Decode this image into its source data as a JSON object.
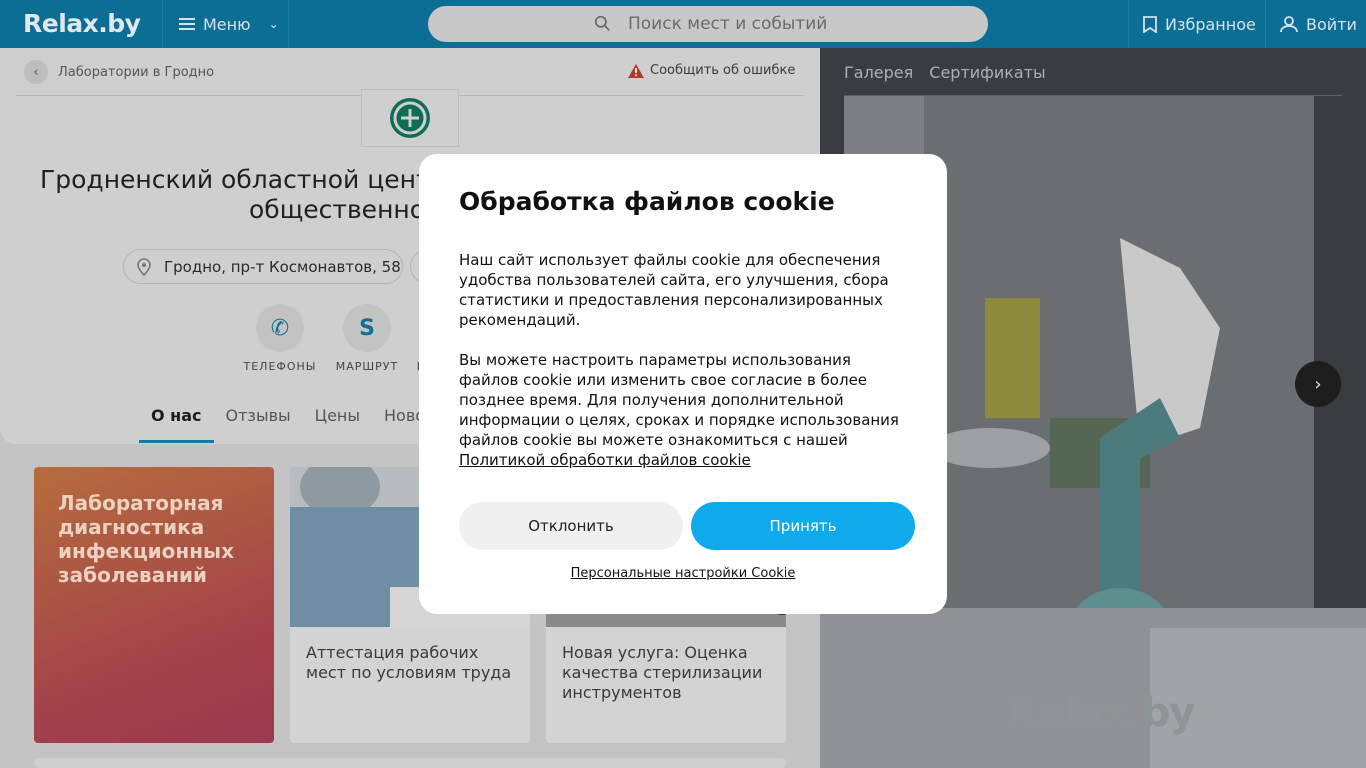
{
  "header": {
    "logo": "Relax.by",
    "menu_label": "Меню",
    "search_placeholder": "Поиск мест и событий",
    "favorites_label": "Избранное",
    "login_label": "Войти"
  },
  "breadcrumb": {
    "back_label": "Лаборатории в Гродно",
    "report_label": "Сообщить об ошибке"
  },
  "org": {
    "title_line1": "Гродненский областной центр",
    "title_line2": "общественно",
    "address": "Гродно, пр-т Космонавтов, 58"
  },
  "actions": [
    {
      "label": "ТЕЛЕФОНЫ",
      "icon": "phone-icon"
    },
    {
      "label": "МАРШРУТ",
      "icon": "route-icon"
    },
    {
      "label": "В",
      "icon": ""
    }
  ],
  "tabs": [
    {
      "label": "О нас",
      "active": true
    },
    {
      "label": "Отзывы",
      "active": false
    },
    {
      "label": "Цены",
      "active": false
    },
    {
      "label": "Ново",
      "active": false
    }
  ],
  "cards": {
    "promo": "Лабораторная диагностика инфекционных заболеваний",
    "news1": "Аттестация рабочих мест по условиям труда",
    "news2": "Новая услуга: Оценка качества стерилизации инструментов"
  },
  "gallery": {
    "tabs": [
      "Галерея",
      "Сертификаты"
    ],
    "watermark": "Relax.by"
  },
  "cookie": {
    "title": "Обработка файлов cookie",
    "paragraph1": "Наш сайт использует файлы cookie для обеспечения удобства пользователей сайта, его улучшения, сбора статистики и предоставления персонализированных рекомендаций.",
    "paragraph2": "Вы можете настроить параметры использования файлов cookie или изменить свое согласие в более позднее время. Для получения дополнительной информации о целях, сроках и порядке использования файлов cookie вы можете ознакомиться с нашей",
    "policy_link": "Политикой обработки файлов cookie",
    "decline_label": "Отклонить",
    "accept_label": "Принять",
    "settings_link": "Персональные настройки Cookie"
  },
  "colors": {
    "header_bg": "#0d6e95",
    "accent": "#0eaaeb",
    "promo": "#a2414a"
  }
}
